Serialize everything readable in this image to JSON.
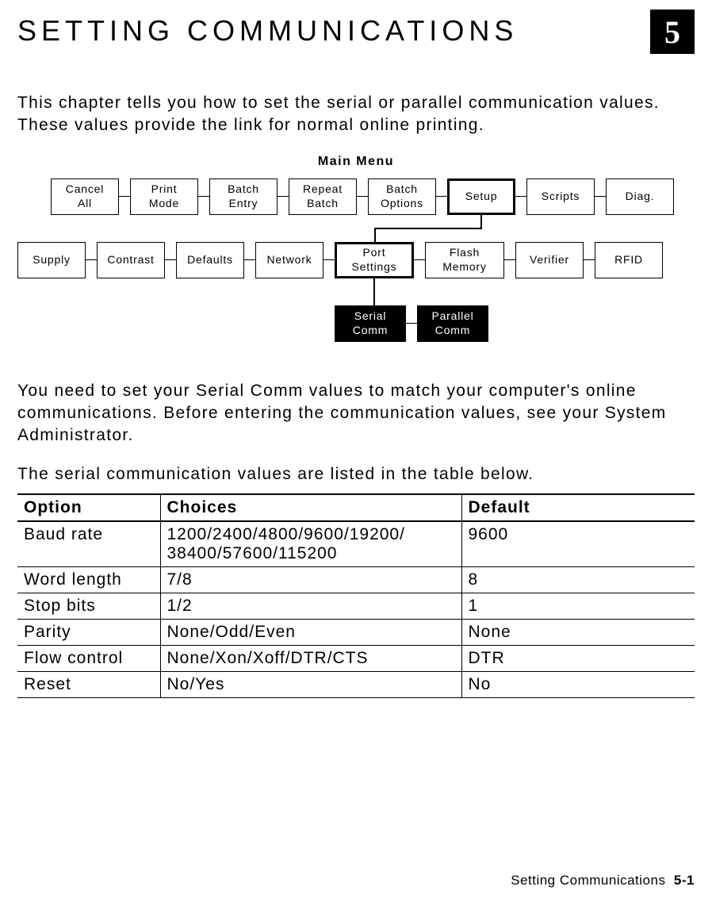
{
  "header": {
    "title": "SETTING COMMUNICATIONS",
    "chapter_number": "5"
  },
  "intro_paragraph": "This chapter tells you how to set the serial or parallel communication values.  These values provide the link for normal online printing.",
  "menu_title": "Main Menu",
  "diagram": {
    "row1": {
      "cancel_all": "Cancel\nAll",
      "print_mode": "Print\nMode",
      "batch_entry": "Batch\nEntry",
      "repeat_batch": "Repeat\nBatch",
      "batch_options": "Batch\nOptions",
      "setup": "Setup",
      "scripts": "Scripts",
      "diag": "Diag."
    },
    "row2": {
      "supply": "Supply",
      "contrast": "Contrast",
      "defaults": "Defaults",
      "network": "Network",
      "port_settings": "Port\nSettings",
      "flash_memory": "Flash\nMemory",
      "verifier": "Verifier",
      "rfid": "RFID"
    },
    "row3": {
      "serial_comm": "Serial\nComm",
      "parallel_comm": "Parallel\nComm"
    }
  },
  "paragraph2": "You need to set your Serial Comm values to match your computer's online communications.  Before entering the communication values, see your System Administrator.",
  "paragraph3": "The serial communication values are listed in the table below.",
  "table": {
    "headers": {
      "option": "Option",
      "choices": "Choices",
      "default": "Default"
    },
    "rows": [
      {
        "option": "Baud rate",
        "choices": "1200/2400/4800/9600/19200/\n38400/57600/115200",
        "default": "9600"
      },
      {
        "option": "Word length",
        "choices": "7/8",
        "default": "8"
      },
      {
        "option": "Stop bits",
        "choices": "1/2",
        "default": "1"
      },
      {
        "option": "Parity",
        "choices": "None/Odd/Even",
        "default": "None"
      },
      {
        "option": "Flow control",
        "choices": "None/Xon/Xoff/DTR/CTS",
        "default": "DTR"
      },
      {
        "option": "Reset",
        "choices": "No/Yes",
        "default": "No"
      }
    ]
  },
  "footer": {
    "section": "Setting Communications",
    "page": "5-1"
  }
}
